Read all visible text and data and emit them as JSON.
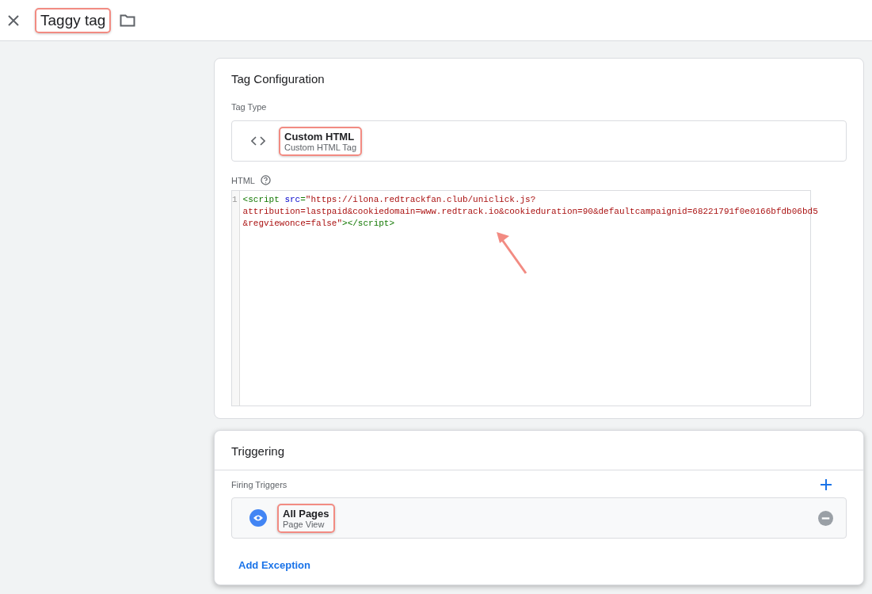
{
  "header": {
    "title": "Taggy tag",
    "title_highlighted": true
  },
  "tag_configuration": {
    "title": "Tag Configuration",
    "tag_type_label": "Tag Type",
    "tag_type": {
      "name": "Custom HTML",
      "subtitle": "Custom HTML Tag",
      "highlighted": true
    },
    "html_label": "HTML",
    "code": {
      "line_number": "1",
      "lines": [
        [
          {
            "kind": "tag",
            "text": "<script "
          },
          {
            "kind": "attr",
            "text": "src"
          },
          {
            "kind": "tag",
            "text": "="
          },
          {
            "kind": "string",
            "text": "\"https://ilona.redtrackfan.club/uniclick.js?"
          }
        ],
        [
          {
            "kind": "string",
            "text": "attribution=lastpaid&cookiedomain=www.redtrack.io&cookieduration=90&defaultcampaignid=68221791f0e0166bfdb06bd5"
          }
        ],
        [
          {
            "kind": "string",
            "text": "&regviewonce=false\""
          },
          {
            "kind": "tag",
            "text": "></script>"
          }
        ]
      ]
    },
    "annotation_arrow": true
  },
  "triggering": {
    "title": "Triggering",
    "firing_label": "Firing Triggers",
    "triggers": [
      {
        "name": "All Pages",
        "subtitle": "Page View",
        "highlighted": true
      }
    ],
    "add_exception": "Add Exception"
  }
}
